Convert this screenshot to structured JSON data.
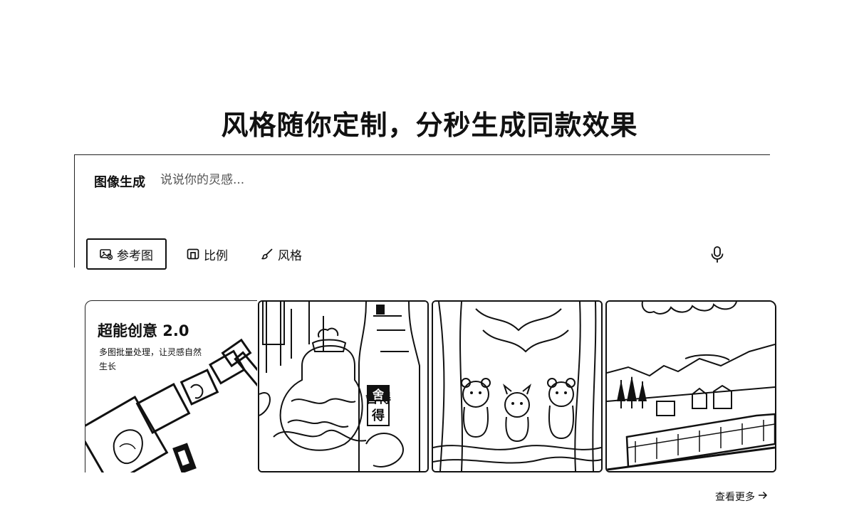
{
  "headline": "风格随你定制，分秒生成同款效果",
  "prompt": {
    "mode_label": "图像生成",
    "placeholder": "说说你的灵感...",
    "value": ""
  },
  "toolbar": {
    "reference_label": "参考图",
    "ratio_label": "比例",
    "style_label": "风格"
  },
  "promo": {
    "title": "超能创意 2.0",
    "description": "多图批量处理，让灵感自然生长"
  },
  "gallery": {
    "thumb_1_text": "舍得",
    "see_more_label": "查看更多"
  },
  "icons": {
    "reference": "image-icon",
    "ratio": "ratio-icon",
    "style": "brush-icon",
    "mic": "microphone-icon",
    "arrow": "arrow-right-icon"
  }
}
